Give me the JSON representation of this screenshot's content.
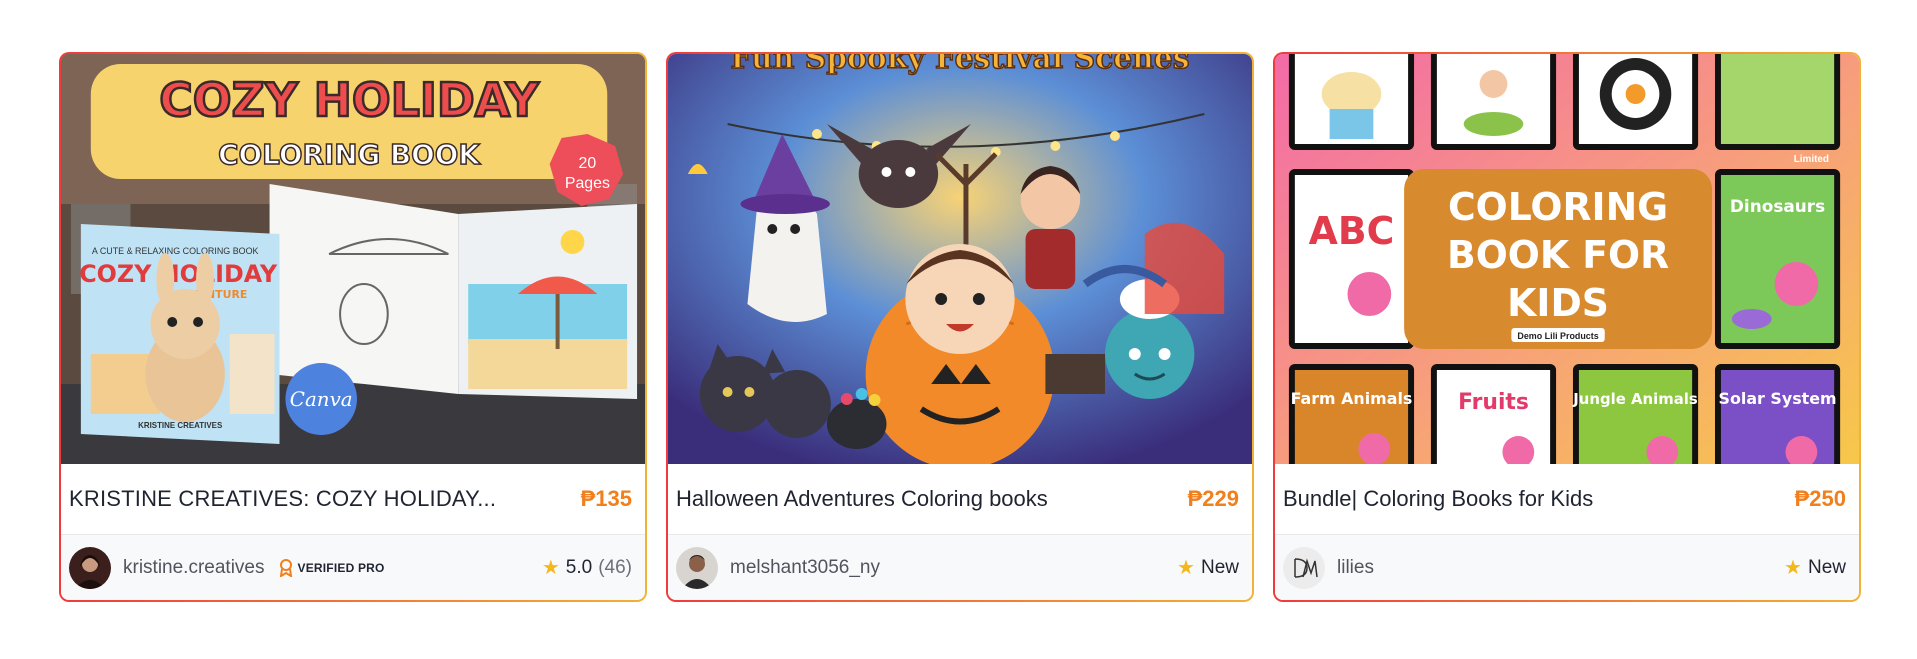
{
  "products": [
    {
      "title": "KRISTINE CREATIVES: COZY HOLIDAY...",
      "price": "₱135",
      "author": "kristine.creatives",
      "badge": "VERIFIED PRO",
      "rating": "5.0",
      "rating_count": "(46)",
      "thumb": {
        "heading1": "COZY HOLIDAY",
        "heading2": "COLORING BOOK",
        "pages_badge_num": "20",
        "pages_badge_word": "Pages",
        "book_tagline": "A CUTE & RELAXING COLORING BOOK",
        "book_title": "COZY HOLIDAY",
        "book_sub": "ADVENTURE",
        "book_author": "KRISTINE CREATIVES",
        "canva": "Canva"
      }
    },
    {
      "title": "Halloween Adventures Coloring books",
      "price": "₱229",
      "author": "melshant3056_ny",
      "status": "New",
      "thumb": {
        "banner": "Fun Spooky Festival Scenes"
      }
    },
    {
      "title": "Bundle| Coloring Books for Kids",
      "price": "₱250",
      "author": "lilies",
      "status": "New",
      "thumb": {
        "center1": "COLORING",
        "center2": "BOOK FOR",
        "center3": "KIDS",
        "center_sub": "Demo Lili Products",
        "limited": "Limited",
        "tiles": [
          "ABC",
          "Dinosaurs",
          "Farm Animals",
          "Fruits",
          "Jungle Animals",
          "Solar System"
        ]
      }
    }
  ],
  "colors": {
    "price": "#f07f1c",
    "star": "#f5b81c",
    "border_start": "#ef3b3b",
    "border_end": "#f2b233"
  }
}
